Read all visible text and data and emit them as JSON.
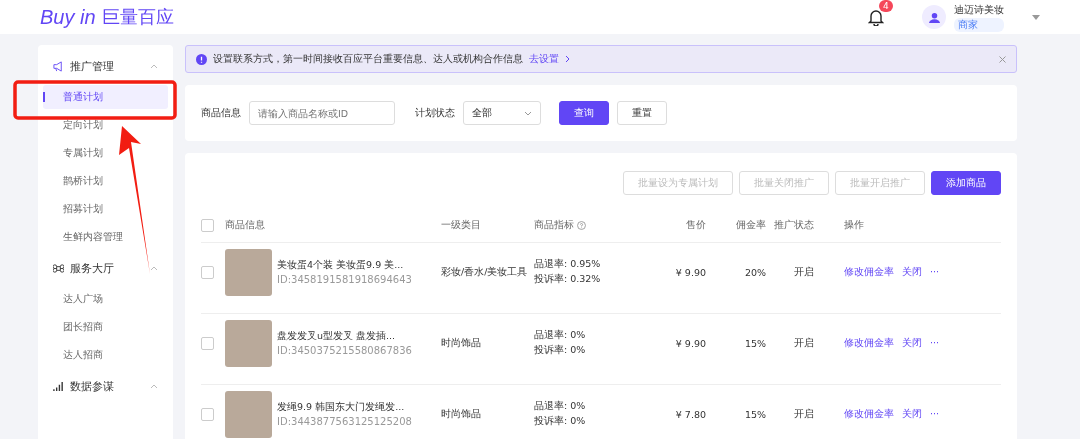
{
  "header": {
    "logo_latin": "Buy in",
    "logo_cn": "巨量百应",
    "notification_count": "4",
    "user_name": "迪迈诗美妆",
    "user_role": "商家"
  },
  "sidebar": [
    {
      "title": "推广管理",
      "kind": "megaphone",
      "expanded": true,
      "children": [
        {
          "label": "普通计划",
          "selected": true
        },
        {
          "label": "定向计划",
          "selected": false
        },
        {
          "label": "专属计划",
          "selected": false
        },
        {
          "label": "鹊桥计划",
          "selected": false
        },
        {
          "label": "招募计划",
          "selected": false
        },
        {
          "label": "生鲜内容管理",
          "selected": false
        }
      ]
    },
    {
      "title": "服务大厅",
      "kind": "command",
      "expanded": true,
      "children": [
        {
          "label": "达人广场",
          "selected": false
        },
        {
          "label": "团长招商",
          "selected": false
        },
        {
          "label": "达人招商",
          "selected": false
        }
      ]
    },
    {
      "title": "数据参谋",
      "kind": "signal",
      "expanded": true
    }
  ],
  "banner": {
    "text": "设置联系方式，第一时间接收百应平台重要信息、达人或机构合作信息",
    "link": "去设置"
  },
  "filters": {
    "product_label": "商品信息",
    "product_placeholder": "请输入商品名称或ID",
    "status_label": "计划状态",
    "status_value": "全部",
    "buttons": [
      {
        "label": "查询",
        "kind": "primary"
      },
      {
        "label": "重置",
        "kind": "default"
      }
    ]
  },
  "table": {
    "all_checked": false,
    "actions": [
      {
        "label": "批量设为专属计划",
        "kind": "disabled"
      },
      {
        "label": "批量关闭推广",
        "kind": "disabled"
      },
      {
        "label": "批量开启推广",
        "kind": "disabled"
      },
      {
        "label": "添加商品",
        "kind": "primary"
      }
    ],
    "columns": [
      {
        "label": "商品信息",
        "help": false
      },
      {
        "label": "一级类目",
        "help": false
      },
      {
        "label": "商品指标",
        "help": true
      },
      {
        "label": "售价",
        "help": false
      },
      {
        "label": "佣金率",
        "help": false
      },
      {
        "label": "推广状态",
        "help": false
      },
      {
        "label": "操作",
        "help": false
      }
    ],
    "rows": [
      {
        "checked": false,
        "title": "美妆蛋4个装 美妆蛋9.9 美...",
        "id": "ID:3458191581918694643",
        "category": "彩妆/香水/美妆工具",
        "return_rate": "品退率: 0.95%",
        "complaint_rate": "投诉率: 0.32%",
        "price": "¥ 9.90",
        "commission": "20%",
        "status": "开启",
        "actions": [
          "修改佣金率",
          "关闭",
          "···"
        ]
      },
      {
        "checked": false,
        "title": "盘发发叉u型发叉 盘发插...",
        "id": "ID:3450375215580867836",
        "category": "时尚饰品",
        "return_rate": "品退率: 0%",
        "complaint_rate": "投诉率: 0%",
        "price": "¥ 9.90",
        "commission": "15%",
        "status": "开启",
        "actions": [
          "修改佣金率",
          "关闭",
          "···"
        ]
      },
      {
        "checked": false,
        "title": "发绳9.9 韩国东大门发绳发...",
        "id": "ID:3443877563125125208",
        "category": "时尚饰品",
        "return_rate": "品退率: 0%",
        "complaint_rate": "投诉率: 0%",
        "price": "¥ 7.80",
        "commission": "15%",
        "status": "开启",
        "actions": [
          "修改佣金率",
          "关闭",
          "···"
        ]
      }
    ]
  }
}
